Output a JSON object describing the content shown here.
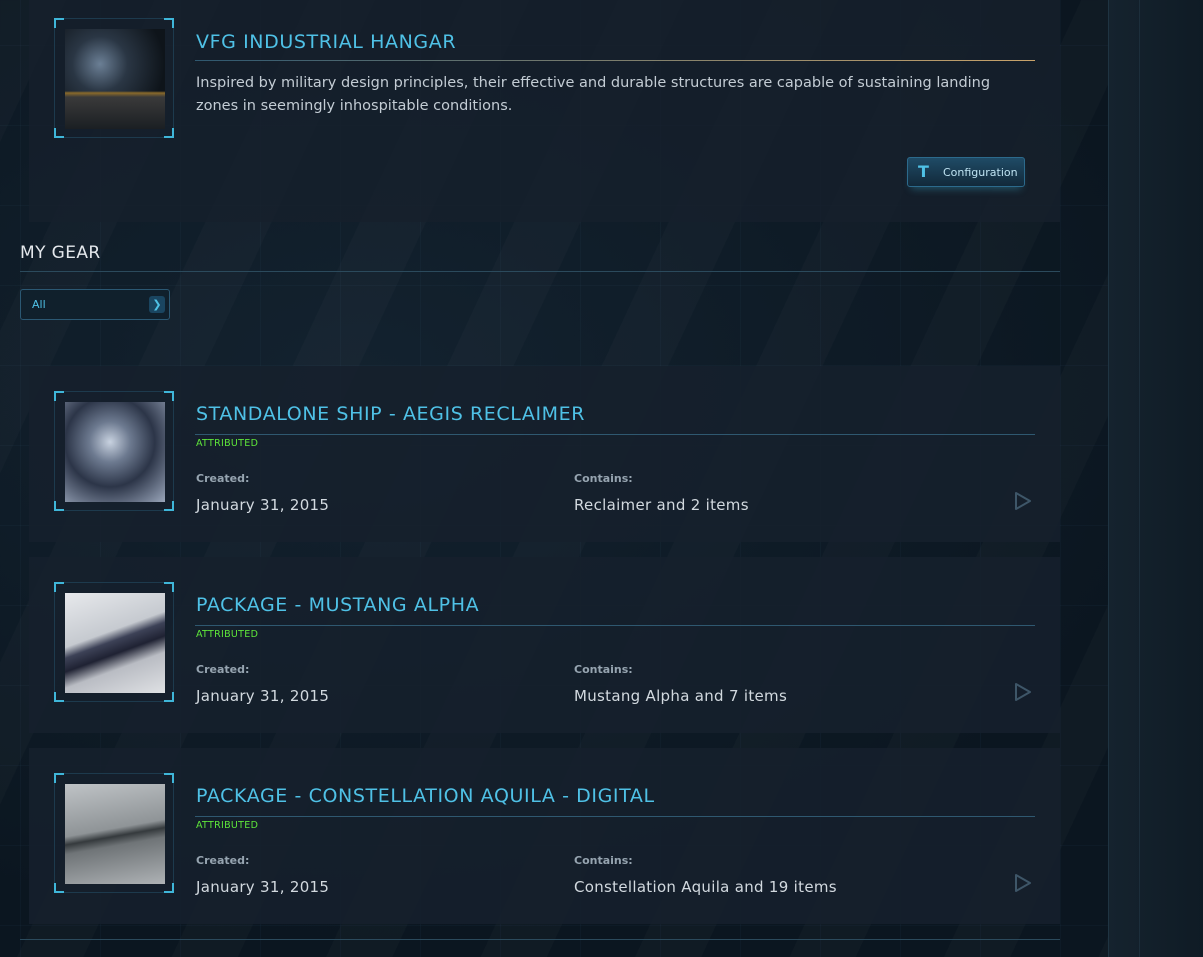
{
  "hangar": {
    "title": "VFG INDUSTRIAL HANGAR",
    "description": "Inspired by military design principles, their effective and durable structures are capable of sustaining landing zones in seemingly inhospitable conditions.",
    "config_button_label": "Configuration",
    "config_icon": "hammer-icon"
  },
  "gear": {
    "section_title": "MY GEAR",
    "filter": {
      "selected": "All",
      "chevron_icon": "chevron-down-icon"
    },
    "created_label": "Created:",
    "contains_label": "Contains:",
    "items": [
      {
        "title": "STANDALONE SHIP - AEGIS RECLAIMER",
        "status": "ATTRIBUTED",
        "created": "January 31, 2015",
        "contains": "Reclaimer and 2 items"
      },
      {
        "title": "PACKAGE - MUSTANG ALPHA",
        "status": "ATTRIBUTED",
        "created": "January 31, 2015",
        "contains": "Mustang Alpha and 7 items"
      },
      {
        "title": "PACKAGE - CONSTELLATION AQUILA - DIGITAL",
        "status": "ATTRIBUTED",
        "created": "January 31, 2015",
        "contains": "Constellation Aquila and 19 items"
      }
    ]
  },
  "colors": {
    "accent": "#4fc1e6",
    "status_green": "#5ee63a",
    "background": "#0c1824"
  }
}
